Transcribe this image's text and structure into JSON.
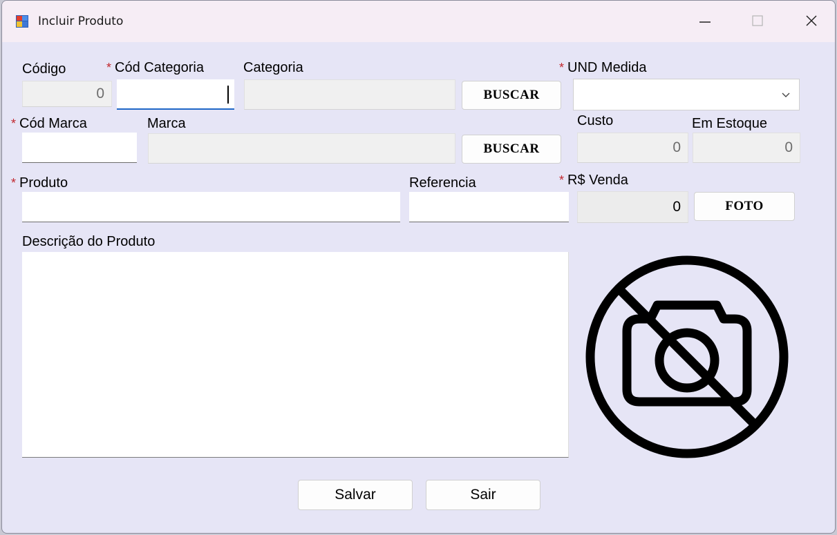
{
  "window": {
    "title": "Incluir Produto"
  },
  "labels": {
    "codigo": "Código",
    "cod_categoria": "Cód Categoria",
    "categoria": "Categoria",
    "und_medida": "UND Medida",
    "cod_marca": "Cód Marca",
    "marca": "Marca",
    "custo": "Custo",
    "em_estoque": "Em Estoque",
    "produto": "Produto",
    "referencia": "Referencia",
    "rs_venda": "R$ Venda",
    "descricao": "Descrição do Produto"
  },
  "required_marker": "*",
  "fields": {
    "codigo": "0",
    "cod_categoria": "",
    "categoria": "",
    "und_medida": "",
    "cod_marca": "",
    "marca": "",
    "custo": "0",
    "em_estoque": "0",
    "produto": "",
    "referencia": "",
    "rs_venda": "0",
    "descricao": ""
  },
  "buttons": {
    "buscar_categoria": "BUSCAR",
    "buscar_marca": "BUSCAR",
    "foto": "FOTO",
    "salvar": "Salvar",
    "sair": "Sair"
  },
  "icons": {
    "photo_placeholder": "no-camera-icon",
    "minimize": "minimize-icon",
    "maximize": "maximize-icon",
    "close": "close-icon"
  }
}
